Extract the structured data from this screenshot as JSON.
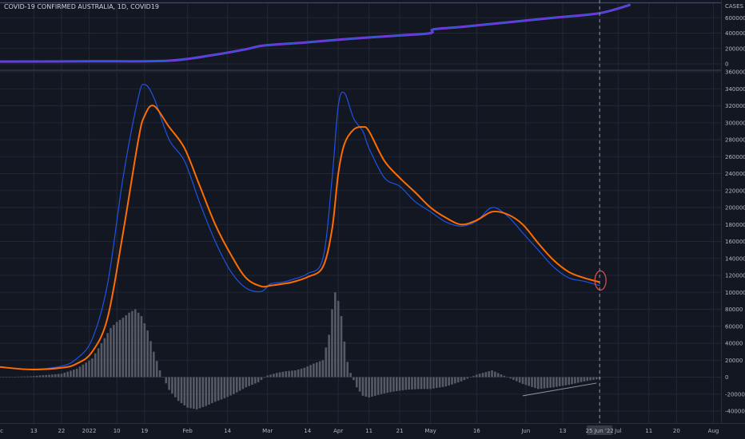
{
  "header": {
    "title": "COVID-19 CONFIRMED AUSTRALIA, 1D, COVID19"
  },
  "colors": {
    "background": "#131722",
    "grid": "#232734",
    "orange": "#ff6d00",
    "blue": "#1e53e5",
    "purple": "#7b3dd6",
    "histogram": "#555a66",
    "marker": "#e05050",
    "divider": "#3342a8"
  },
  "chart_data": [
    {
      "type": "line",
      "panel": "top",
      "title": "",
      "yaxis_label": "CASES",
      "ylim": [
        0,
        8000000
      ],
      "yticks": [
        "0",
        "2000000",
        "4000000",
        "6000000"
      ],
      "x": [
        0,
        30,
        55,
        70,
        80,
        86,
        100,
        115,
        130,
        140,
        141,
        150,
        165,
        180,
        195,
        205
      ],
      "series": [
        {
          "name": "",
          "values": [
            300000,
            330000,
            420000,
            1200000,
            1900000,
            2400000,
            2800000,
            3300000,
            3700000,
            4000000,
            4500000,
            4800000,
            5400000,
            6000000,
            6600000,
            7700000
          ]
        }
      ]
    },
    {
      "type": "line",
      "panel": "main",
      "title": "",
      "ylim": [
        -40000,
        360000
      ],
      "yticks": [
        "-40000",
        "-20000",
        "0",
        "20000",
        "40000",
        "60000",
        "80000",
        "100000",
        "120000",
        "140000",
        "160000",
        "180000",
        "200000",
        "220000",
        "240000",
        "260000",
        "280000",
        "300000",
        "320000",
        "340000",
        "360000"
      ],
      "xticks": [
        {
          "label": "c",
          "day": -2
        },
        {
          "label": "13",
          "day": 11
        },
        {
          "label": "22",
          "day": 20
        },
        {
          "label": "2022",
          "day": 29
        },
        {
          "label": "10",
          "day": 38
        },
        {
          "label": "19",
          "day": 47
        },
        {
          "label": "Feb",
          "day": 61
        },
        {
          "label": "14",
          "day": 74
        },
        {
          "label": "Mar",
          "day": 87
        },
        {
          "label": "14",
          "day": 100
        },
        {
          "label": "Apr",
          "day": 110
        },
        {
          "label": "11",
          "day": 120
        },
        {
          "label": "21",
          "day": 130
        },
        {
          "label": "May",
          "day": 140
        },
        {
          "label": "16",
          "day": 155
        },
        {
          "label": "Jun",
          "day": 171
        },
        {
          "label": "13",
          "day": 183
        },
        {
          "label": "25 Jun '22",
          "day": 195,
          "highlight": true
        },
        {
          "label": "Jul",
          "day": 201
        },
        {
          "label": "11",
          "day": 211
        },
        {
          "label": "20",
          "day": 220
        },
        {
          "label": "Aug",
          "day": 232
        }
      ],
      "x": [
        0,
        10,
        20,
        25,
        30,
        35,
        40,
        45,
        47,
        50,
        55,
        60,
        65,
        70,
        75,
        80,
        85,
        88,
        92,
        95,
        100,
        105,
        108,
        110,
        112,
        115,
        118,
        120,
        125,
        130,
        135,
        140,
        145,
        150,
        155,
        160,
        165,
        170,
        175,
        180,
        185,
        190,
        195
      ],
      "series": [
        {
          "name": "",
          "color": "orange",
          "values": [
            12000,
            9000,
            11000,
            16000,
            30000,
            70000,
            170000,
            280000,
            308000,
            320000,
            295000,
            270000,
            225000,
            180000,
            145000,
            117000,
            107000,
            108000,
            110000,
            112000,
            118000,
            130000,
            175000,
            240000,
            275000,
            292000,
            295000,
            290000,
            255000,
            235000,
            218000,
            200000,
            188000,
            180000,
            185000,
            195000,
            192000,
            180000,
            158000,
            138000,
            124000,
            117000,
            112000
          ]
        },
        {
          "name": "",
          "color": "blue",
          "values": [
            12000,
            9000,
            13000,
            22000,
            45000,
            110000,
            235000,
            330000,
            345000,
            330000,
            280000,
            255000,
            205000,
            160000,
            125000,
            105000,
            101000,
            110000,
            112000,
            115000,
            122000,
            140000,
            235000,
            320000,
            335000,
            305000,
            290000,
            270000,
            235000,
            225000,
            207000,
            195000,
            183000,
            178000,
            184000,
            200000,
            190000,
            170000,
            150000,
            130000,
            117000,
            113000,
            108000
          ]
        }
      ],
      "histogram": {
        "x": [
          0,
          10,
          20,
          25,
          30,
          33,
          36,
          38,
          40,
          42,
          44,
          46,
          48,
          50,
          52,
          55,
          58,
          61,
          64,
          67,
          70,
          73,
          76,
          80,
          84,
          87,
          90,
          93,
          96,
          99,
          102,
          105,
          107,
          108,
          109,
          110,
          111,
          112,
          113,
          114,
          116,
          118,
          120,
          124,
          128,
          132,
          136,
          140,
          145,
          150,
          155,
          160,
          165,
          170,
          175,
          180,
          185,
          190,
          195
        ],
        "values": [
          0,
          1000,
          4000,
          10000,
          22000,
          40000,
          58000,
          65000,
          70000,
          76000,
          80000,
          72000,
          55000,
          30000,
          8000,
          -15000,
          -28000,
          -36000,
          -38000,
          -34000,
          -29000,
          -25000,
          -20000,
          -12000,
          -6000,
          2000,
          5000,
          7000,
          8000,
          11000,
          16000,
          20000,
          50000,
          80000,
          100000,
          90000,
          72000,
          42000,
          18000,
          5000,
          -12000,
          -22000,
          -24000,
          -20000,
          -17000,
          -15000,
          -14000,
          -14000,
          -11000,
          -5000,
          3000,
          8000,
          0,
          -8000,
          -14000,
          -12000,
          -9000,
          -5000,
          -2000
        ]
      },
      "trend_line": {
        "x": [
          170,
          194
        ],
        "y": [
          -22000,
          -7000
        ]
      },
      "marker_circle": {
        "x": 195,
        "y": 114000
      }
    }
  ]
}
